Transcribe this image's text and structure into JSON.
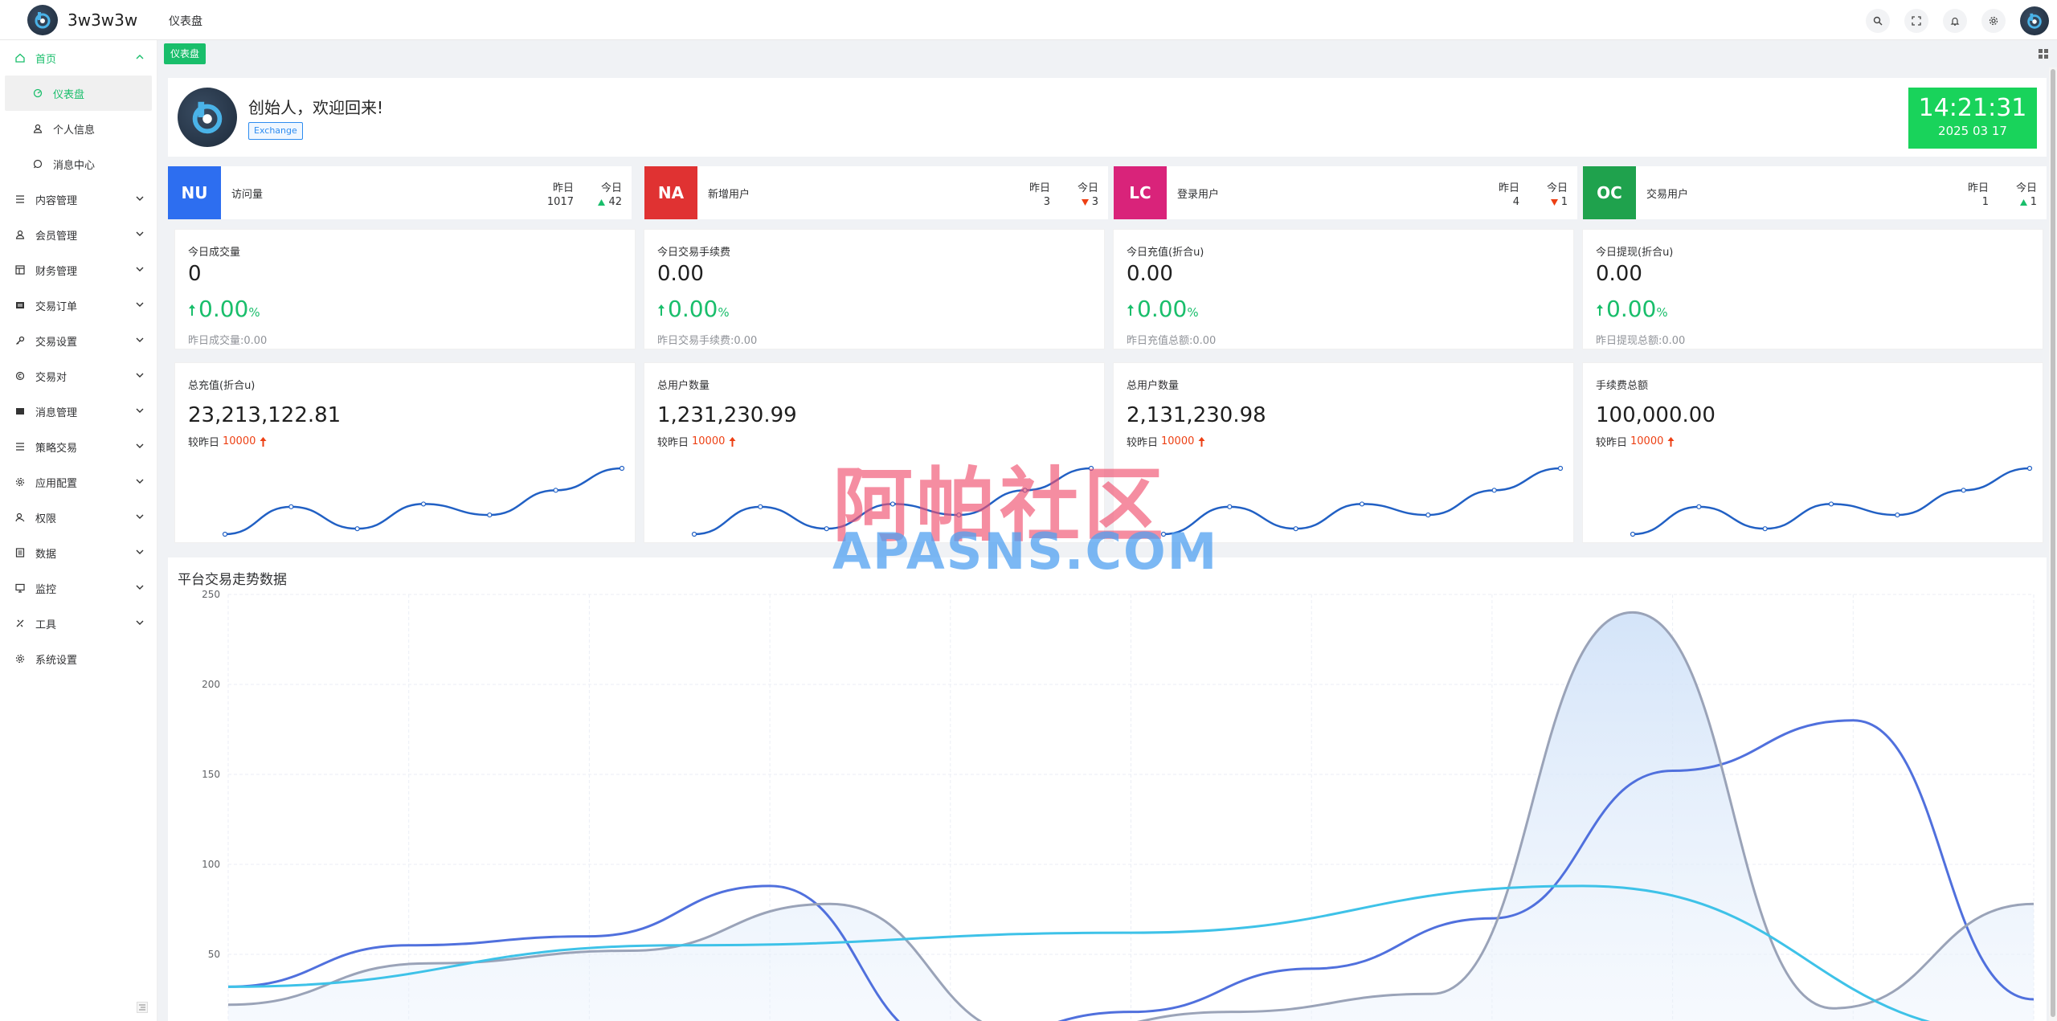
{
  "app": {
    "logo_text": "3w3w3w",
    "page_title": "仪表盘"
  },
  "header": {
    "icons": [
      "search-icon",
      "fullscreen-icon",
      "bell-icon",
      "settings-icon",
      "avatar"
    ]
  },
  "sidebar": {
    "items": [
      {
        "label": "首页",
        "icon": "home-icon",
        "expanded": true
      },
      {
        "label": "仪表盘",
        "icon": "dashboard-icon",
        "sub": true,
        "active": true
      },
      {
        "label": "个人信息",
        "icon": "user-icon",
        "sub": true
      },
      {
        "label": "消息中心",
        "icon": "message-icon",
        "sub": true
      },
      {
        "label": "内容管理",
        "icon": "list-icon"
      },
      {
        "label": "会员管理",
        "icon": "user-icon"
      },
      {
        "label": "财务管理",
        "icon": "finance-icon"
      },
      {
        "label": "交易订单",
        "icon": "order-icon"
      },
      {
        "label": "交易设置",
        "icon": "key-icon"
      },
      {
        "label": "交易对",
        "icon": "coin-icon"
      },
      {
        "label": "消息管理",
        "icon": "mail-icon"
      },
      {
        "label": "策略交易",
        "icon": "list-icon"
      },
      {
        "label": "应用配置",
        "icon": "config-icon"
      },
      {
        "label": "权限",
        "icon": "permission-icon"
      },
      {
        "label": "数据",
        "icon": "data-icon"
      },
      {
        "label": "监控",
        "icon": "monitor-icon"
      },
      {
        "label": "工具",
        "icon": "tool-icon"
      },
      {
        "label": "系统设置",
        "icon": "gear-icon"
      }
    ]
  },
  "tags": {
    "active": "仪表盘"
  },
  "welcome": {
    "greeting": "创始人，欢迎回来!",
    "badge": "Exchange",
    "time": "14:21:31",
    "date": "2025 03 17"
  },
  "stats": [
    {
      "code": "NU",
      "color": "#2d6ef0",
      "name": "访问量",
      "yesterday_label": "昨日",
      "today_label": "今日",
      "yesterday": "1017",
      "today": "42",
      "trend": "up"
    },
    {
      "code": "NA",
      "color": "#e03232",
      "name": "新增用户",
      "yesterday_label": "昨日",
      "today_label": "今日",
      "yesterday": "3",
      "today": "3",
      "trend": "down"
    },
    {
      "code": "LC",
      "color": "#d9237a",
      "name": "登录用户",
      "yesterday_label": "昨日",
      "today_label": "今日",
      "yesterday": "4",
      "today": "1",
      "trend": "down"
    },
    {
      "code": "OC",
      "color": "#1fa24d",
      "name": "交易用户",
      "yesterday_label": "昨日",
      "today_label": "今日",
      "yesterday": "1",
      "today": "1",
      "trend": "up"
    }
  ],
  "metrics_row1": [
    {
      "label": "今日成交量",
      "value": "0",
      "pct": "0.00",
      "pct_unit": "%",
      "foot": "昨日成交量:0.00"
    },
    {
      "label": "今日交易手续费",
      "value": "0.00",
      "pct": "0.00",
      "pct_unit": "%",
      "foot": "昨日交易手续费:0.00"
    },
    {
      "label": "今日充值(折合u)",
      "value": "0.00",
      "pct": "0.00",
      "pct_unit": "%",
      "foot": "昨日充值总额:0.00"
    },
    {
      "label": "今日提现(折合u)",
      "value": "0.00",
      "pct": "0.00",
      "pct_unit": "%",
      "foot": "昨日提现总额:0.00"
    }
  ],
  "metrics_row2": [
    {
      "label": "总充值(折合u)",
      "value": "23,213,122.81",
      "compare_label": "较昨日",
      "compare_value": "10000"
    },
    {
      "label": "总用户数量",
      "value": "1,231,230.99",
      "compare_label": "较昨日",
      "compare_value": "10000"
    },
    {
      "label": "总用户数量",
      "value": "2,131,230.98",
      "compare_label": "较昨日",
      "compare_value": "10000"
    },
    {
      "label": "手续费总额",
      "value": "100,000.00",
      "compare_label": "较昨日",
      "compare_value": "10000"
    }
  ],
  "sparkline": {
    "values": [
      0,
      5,
      1,
      5.5,
      3.5,
      8,
      12
    ]
  },
  "watermark": {
    "cn": "阿帕社区",
    "en": "APASNS.COM"
  },
  "chart_data": {
    "type": "area",
    "title": "平台交易走势数据",
    "y_ticks": [
      "250",
      "200",
      "150",
      "100",
      "50"
    ],
    "ylim": [
      0,
      250
    ],
    "x_count": 10,
    "grid": true,
    "series": [
      {
        "values": [
          32,
          55,
          60,
          88,
          0,
          18,
          42,
          70,
          152,
          180,
          25
        ],
        "color": "#5070dd"
      },
      {
        "values": [
          22,
          45,
          52,
          78,
          5,
          18,
          28,
          240,
          20,
          78
        ],
        "color": "#9aa3b8"
      },
      {
        "values": [
          32,
          55,
          62,
          88,
          5
        ],
        "color": "#3ec2e8"
      }
    ]
  }
}
